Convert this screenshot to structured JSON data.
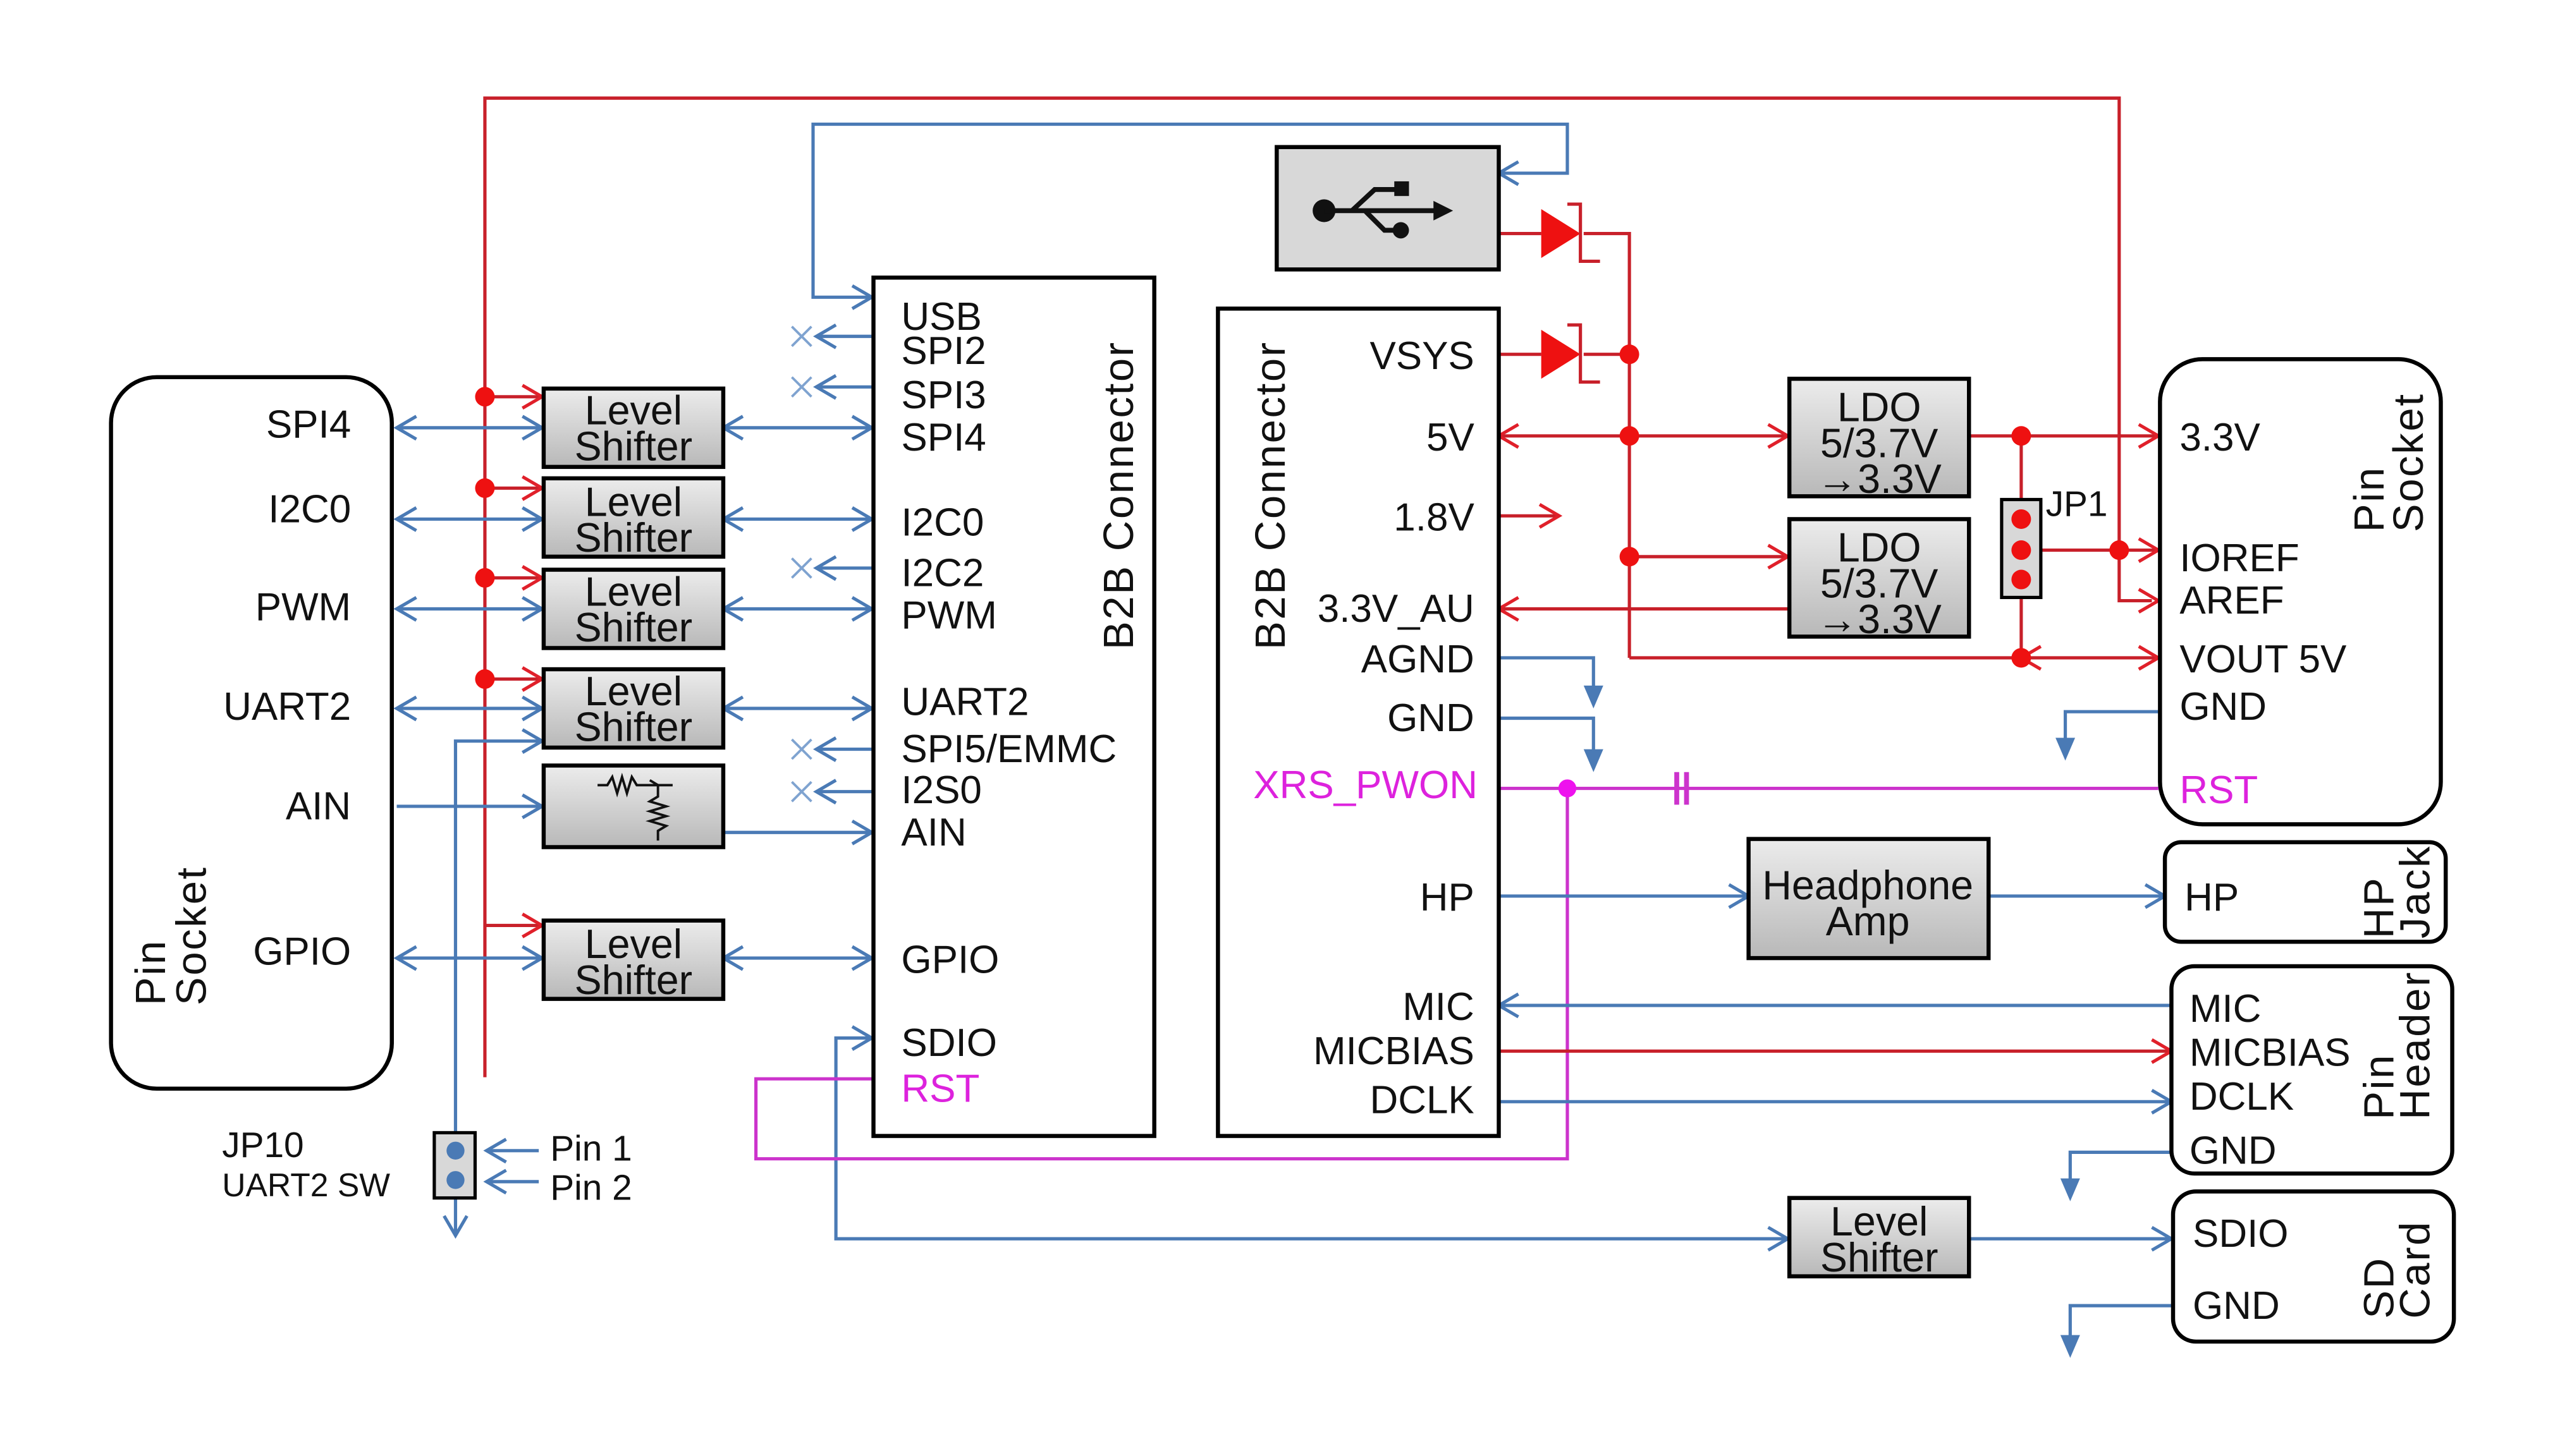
{
  "left_socket": {
    "title_line1": "Pin",
    "title_line2": "Socket",
    "pins": [
      "SPI4",
      "I2C0",
      "PWM",
      "UART2",
      "AIN",
      "GPIO"
    ]
  },
  "level_shifter_label": [
    "Level",
    "Shifter"
  ],
  "jp10": {
    "name": "JP10",
    "desc": "UART2 SW",
    "pin1": "Pin 1",
    "pin2": "Pin 2"
  },
  "b2b_left": {
    "title": "B2B Connector",
    "pins": [
      "USB",
      "SPI2",
      "SPI3",
      "SPI4",
      "I2C0",
      "I2C2",
      "PWM",
      "UART2",
      "SPI5/EMMC",
      "I2S0",
      "AIN",
      "GPIO",
      "SDIO"
    ],
    "rst": "RST"
  },
  "b2b_right": {
    "title": "B2B Connector",
    "pins": [
      "VSYS",
      "5V",
      "1.8V",
      "3.3V_AU",
      "AGND",
      "GND",
      "HP",
      "MIC",
      "MICBIAS",
      "DCLK"
    ],
    "xrs": "XRS_PWON"
  },
  "usb_icon": "usb-icon",
  "ldo": {
    "line1": "LDO",
    "line2": "5/3.7V",
    "line3": "→3.3V"
  },
  "jp1": "JP1",
  "right_socket": {
    "title_line1": "Pin",
    "title_line2": "Socket",
    "pins": [
      "3.3V",
      "IOREF",
      "AREF",
      "VOUT 5V",
      "GND"
    ],
    "rst": "RST"
  },
  "headphone_amp": [
    "Headphone",
    "Amp"
  ],
  "hp_jack": {
    "title_line1": "HP",
    "title_line2": "Jack",
    "pin": "HP"
  },
  "pin_header": {
    "title_line1": "Pin",
    "title_line2": "Header",
    "pins": [
      "MIC",
      "MICBIAS",
      "DCLK",
      "GND"
    ]
  },
  "sd_card": {
    "title_line1": "SD",
    "title_line2": "Card",
    "pins": [
      "SDIO",
      "GND"
    ]
  },
  "colors": {
    "signal": "#4a7ab5",
    "power": "#c8202a",
    "reset": "#cc33cc"
  }
}
